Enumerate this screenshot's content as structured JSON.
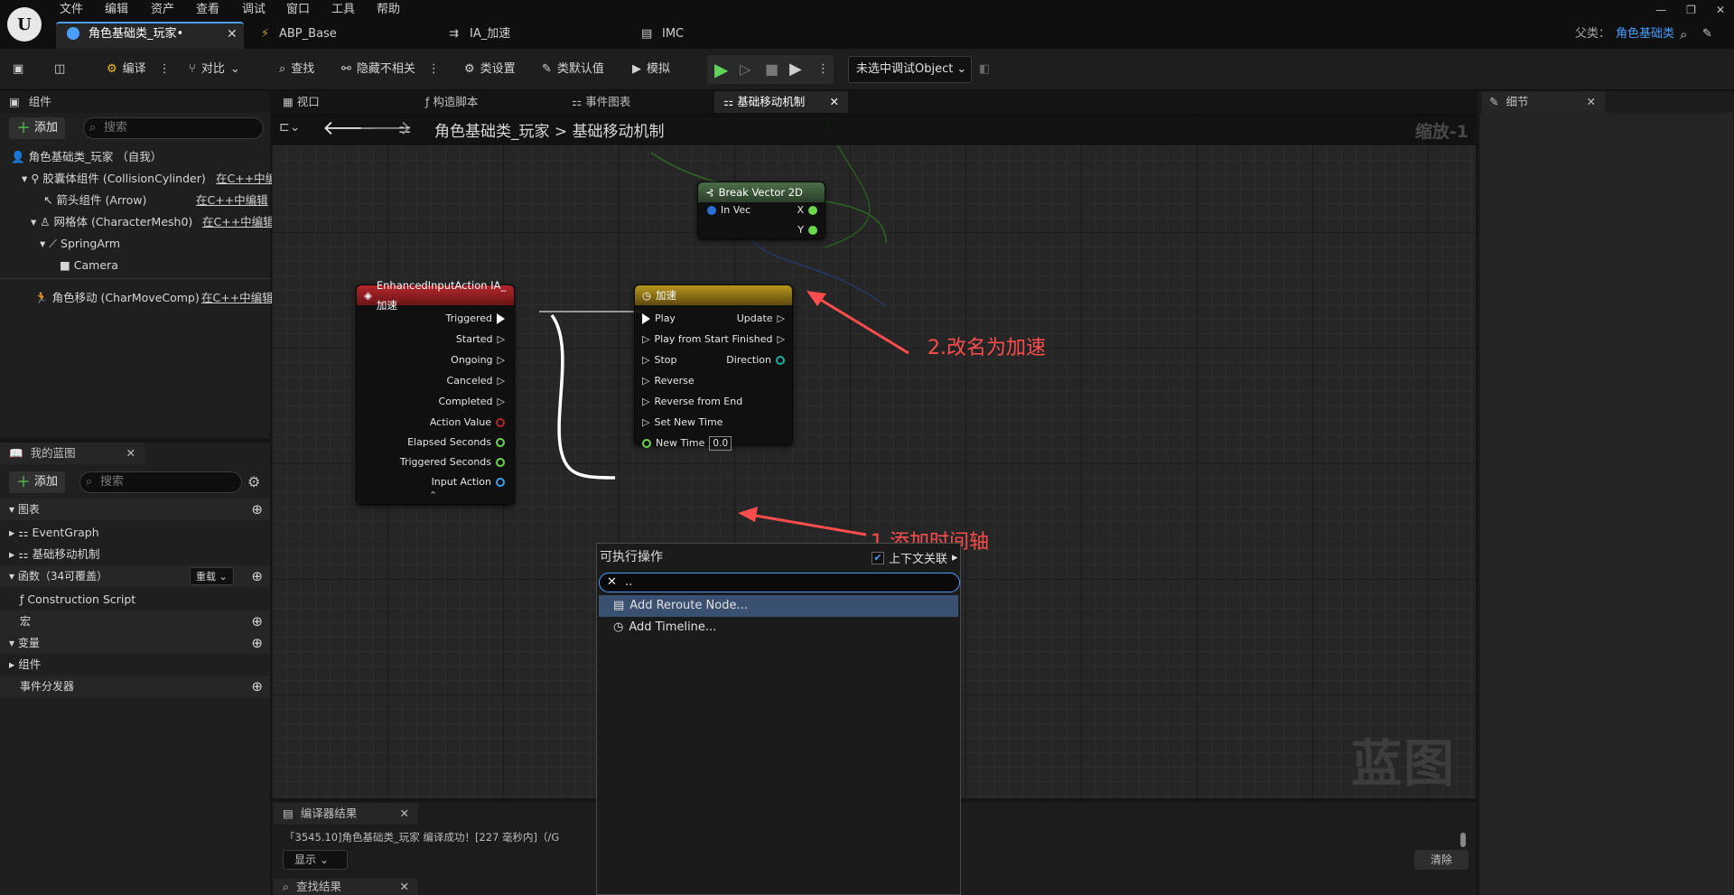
{
  "menu": [
    "文件",
    "编辑",
    "资产",
    "查看",
    "调试",
    "窗口",
    "工具",
    "帮助"
  ],
  "tabs": [
    {
      "label": "角色基础类_玩家•",
      "active": true
    },
    {
      "label": "ABP_Base"
    },
    {
      "label": "IA_加速"
    },
    {
      "label": "IMC"
    }
  ],
  "parent": {
    "label": "父类：",
    "value": "角色基础类"
  },
  "toolbar": {
    "compile": "编译",
    "diff": "对比",
    "find": "查找",
    "hide_unrelated": "隐藏不相关",
    "class_settings": "类设置",
    "class_defaults": "类默认值",
    "simulate": "模拟",
    "debug_object": "未选中调试Object"
  },
  "components": {
    "title": "组件",
    "add": "添加",
    "search_placeholder": "搜索",
    "items": [
      {
        "label": "角色基础类_玩家 （自我）"
      },
      {
        "label": "胶囊体组件 (CollisionCylinder)",
        "link": "在C++中编"
      },
      {
        "label": "箭头组件 (Arrow)",
        "link": "在C++中编辑"
      },
      {
        "label": "网格体 (CharacterMesh0)",
        "link": "在C++中编辑"
      },
      {
        "label": "SpringArm"
      },
      {
        "label": "Camera"
      },
      {
        "label": "角色移动 (CharMoveComp)",
        "link": "在C++中编辑"
      }
    ]
  },
  "myblueprint": {
    "title": "我的蓝图",
    "add": "添加",
    "search_placeholder": "搜索",
    "graphs_title": "图表",
    "graphs": [
      "EventGraph",
      "基础移动机制"
    ],
    "functions_title": "函数（34可覆盖）",
    "override": "重载",
    "functions": [
      "Construction Script"
    ],
    "macros_title": "宏",
    "variables_title": "变量",
    "var_components": "组件",
    "dispatchers_title": "事件分发器"
  },
  "graph_tabs": [
    {
      "label": "视口"
    },
    {
      "label": "构造脚本"
    },
    {
      "label": "事件图表"
    },
    {
      "label": "基础移动机制",
      "active": true
    }
  ],
  "breadcrumb": {
    "root": "角色基础类_玩家",
    "sep": ">",
    "current": "基础移动机制"
  },
  "zoom": "缩放-1",
  "watermark": "蓝图",
  "nodes": {
    "break_vector": {
      "title": "Break Vector 2D",
      "input": "In Vec",
      "outputs": [
        "X",
        "Y"
      ]
    },
    "input_action": {
      "title": "EnhancedInputAction IA_加速",
      "pins": [
        "Triggered",
        "Started",
        "Ongoing",
        "Canceled",
        "Completed",
        "Action Value",
        "Elapsed Seconds",
        "Triggered Seconds",
        "Input Action"
      ]
    },
    "timeline": {
      "title": "加速",
      "inputs": [
        "Play",
        "Play from Start",
        "Stop",
        "Reverse",
        "Reverse from End",
        "Set New Time",
        "New Time"
      ],
      "outputs": [
        "Update",
        "Finished",
        "Direction"
      ],
      "new_time_value": "0.0"
    }
  },
  "popup": {
    "title": "可执行操作",
    "context_label": "上下文关联",
    "search_value": "..",
    "items": [
      "Add Reroute Node...",
      "Add Timeline..."
    ]
  },
  "annotations": [
    "2.改名为加速",
    "1.添加时间轴"
  ],
  "details": {
    "title": "细节"
  },
  "compiler": {
    "title": "编译器结果",
    "log": "「3545.10]角色基础类_玩家 编译成功！[227 毫秒内]（/G",
    "show": "显示",
    "clear": "清除"
  },
  "find_results": {
    "title": "查找结果"
  },
  "colors": {
    "accent": "#4a9fff",
    "annotation": "#ff4d4d",
    "exec_green": "#6bd64f",
    "node_red": "#b3262a",
    "node_gold": "#b8961c"
  }
}
